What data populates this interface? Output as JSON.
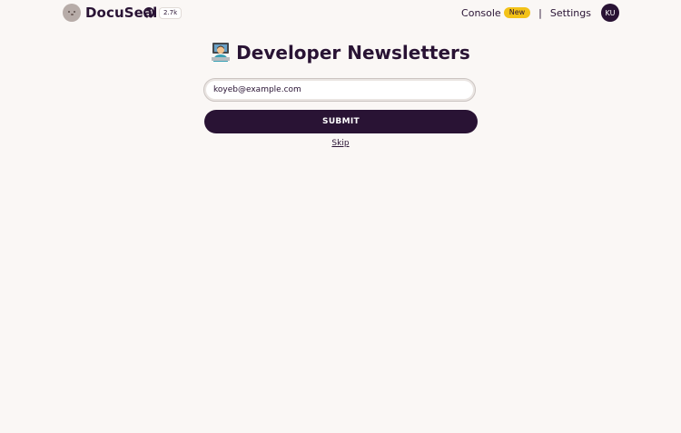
{
  "navbar": {
    "brand_name": "DocuSeal",
    "github_stars": "2.7k",
    "console_label": "Console",
    "console_badge": "New",
    "divider": "|",
    "settings_label": "Settings",
    "avatar_initials": "KU",
    "icons": {
      "logo": "docuseal-seal-logo",
      "github": "github-icon"
    }
  },
  "main": {
    "title": "Developer Newsletters",
    "title_icon": "technologist-emoji",
    "email_value": "koyeb@example.com",
    "submit_label": "SUBMIT",
    "skip_label": "Skip"
  },
  "colors": {
    "background": "#faf7f5",
    "primary": "#291334",
    "badge": "#f3c218"
  }
}
